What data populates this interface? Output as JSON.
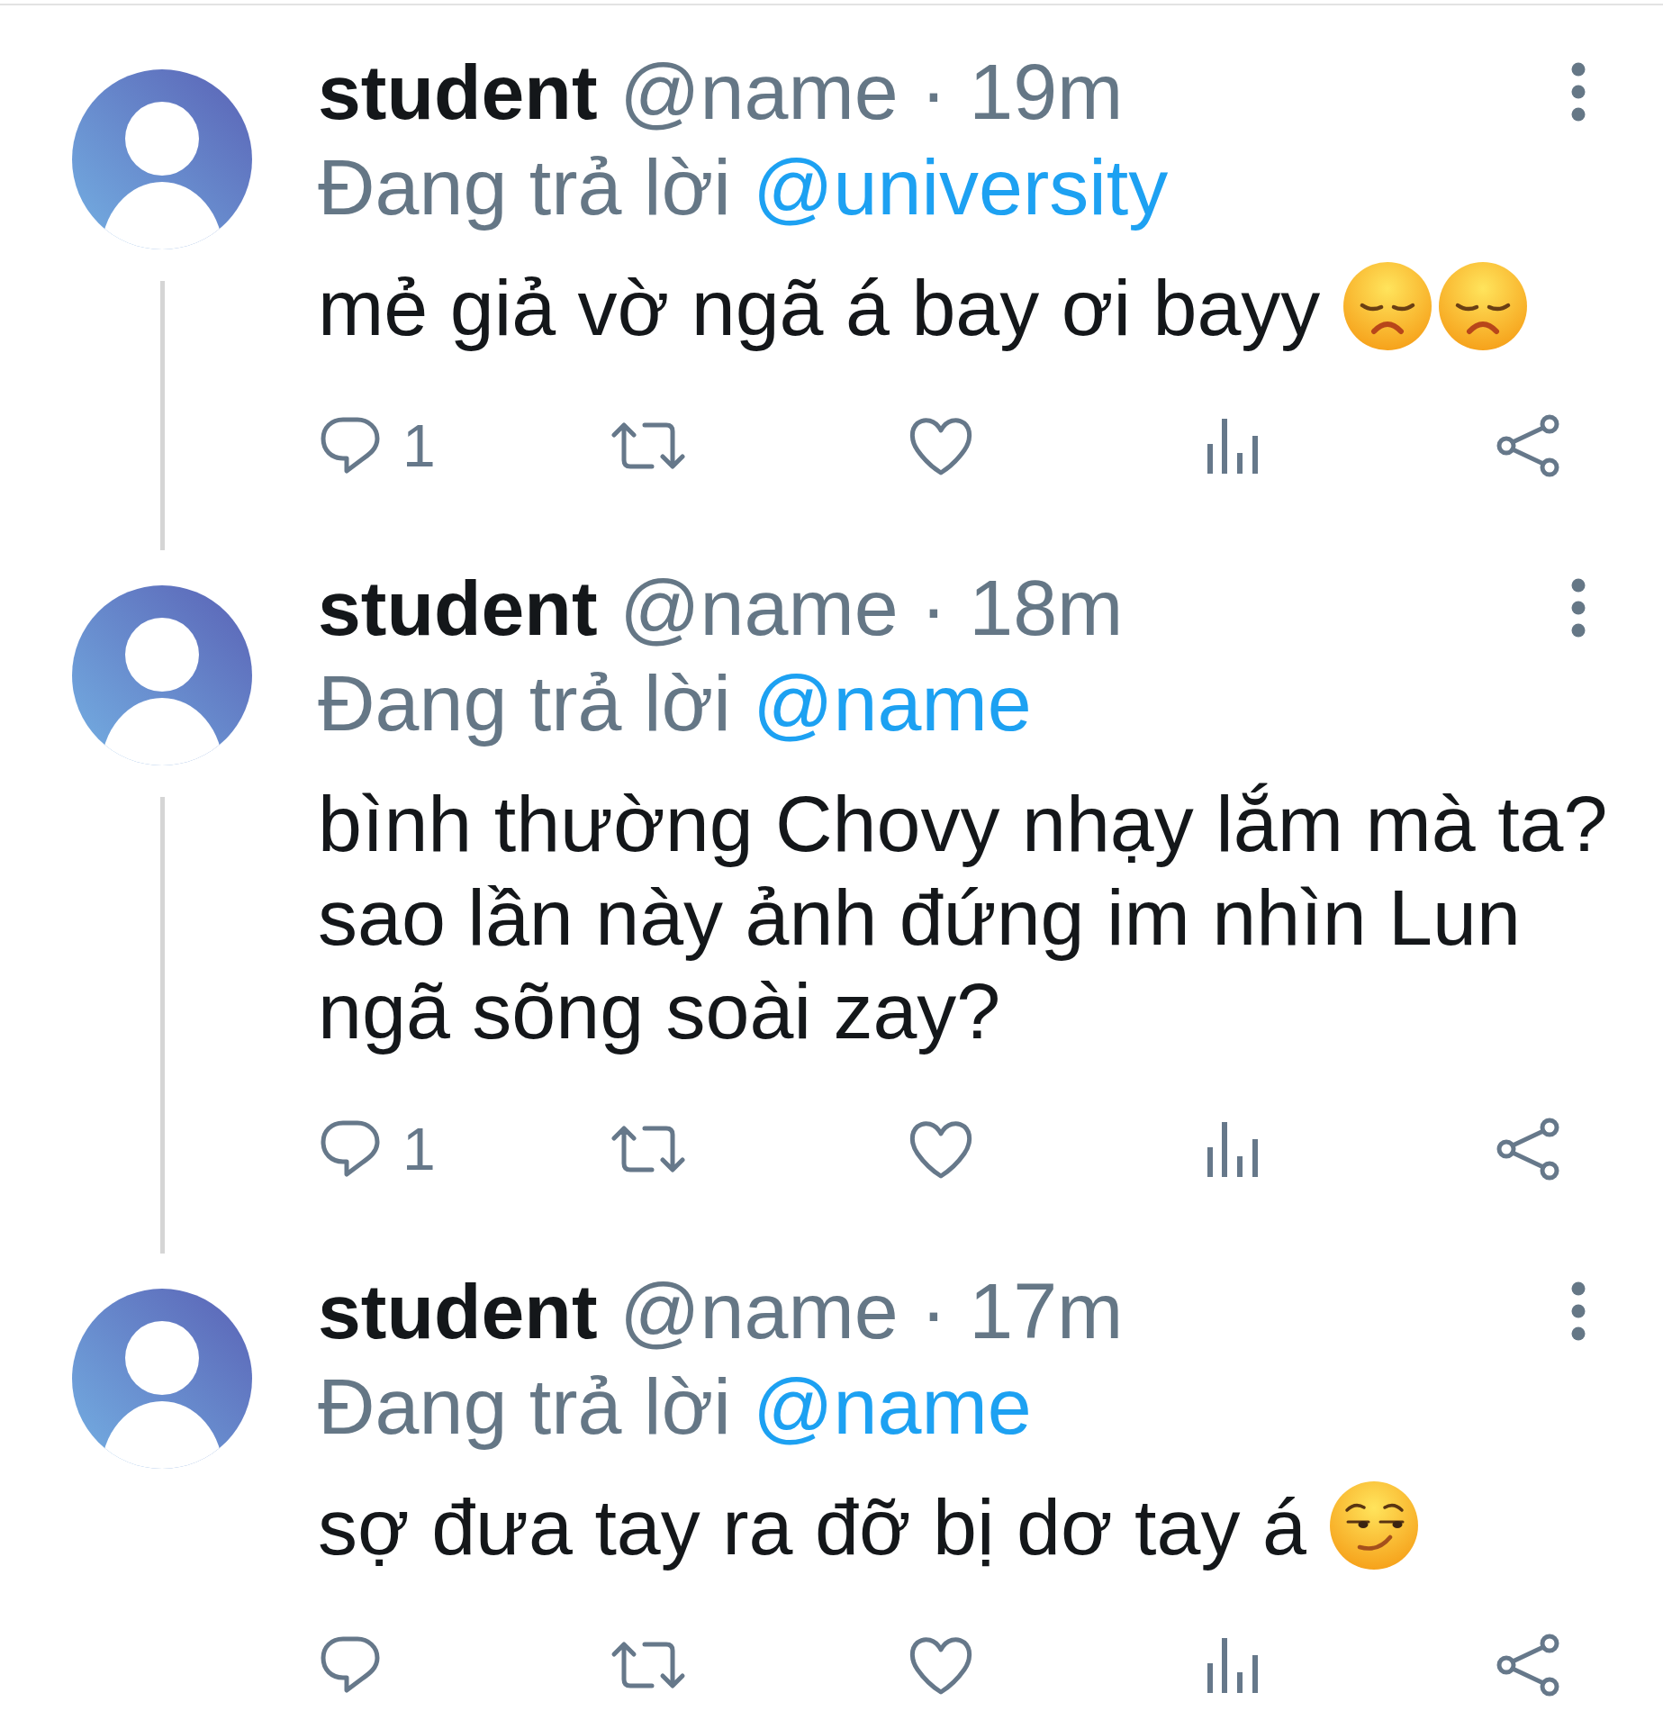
{
  "tweets": [
    {
      "author": "student",
      "handle": "@name",
      "separator": "·",
      "time": "19m",
      "reply_label": "Đang trả lời",
      "reply_to": "@university",
      "text": "mẻ giả vờ ngã á bay ơi bayy",
      "emojis": [
        {
          "kind": "disappointed"
        },
        {
          "kind": "disappointed"
        }
      ],
      "thread_line": true,
      "actions": [
        {
          "kind": "reply",
          "count": "1"
        },
        {
          "kind": "retweet"
        },
        {
          "kind": "like"
        },
        {
          "kind": "views"
        },
        {
          "kind": "share"
        }
      ]
    },
    {
      "author": "student",
      "handle": "@name",
      "separator": "·",
      "time": "18m",
      "reply_label": "Đang trả lời",
      "reply_to": "@name",
      "text": "bình thường Chovy nhạy lắm mà ta?\nsao lần này ảnh đứng im nhìn Lun\nngã sõng soài zay?",
      "thread_line": true,
      "actions": [
        {
          "kind": "reply",
          "count": "1"
        },
        {
          "kind": "retweet"
        },
        {
          "kind": "like"
        },
        {
          "kind": "views"
        },
        {
          "kind": "share"
        }
      ]
    },
    {
      "author": "student",
      "handle": "@name",
      "separator": "·",
      "time": "17m",
      "reply_label": "Đang trả lời",
      "reply_to": "@name",
      "text": "sợ đưa tay ra đỡ bị dơ tay á",
      "emojis": [
        {
          "kind": "smirking"
        }
      ],
      "thread_line": false,
      "actions": [
        {
          "kind": "reply"
        },
        {
          "kind": "retweet"
        },
        {
          "kind": "like"
        },
        {
          "kind": "views"
        },
        {
          "kind": "share"
        }
      ]
    }
  ]
}
